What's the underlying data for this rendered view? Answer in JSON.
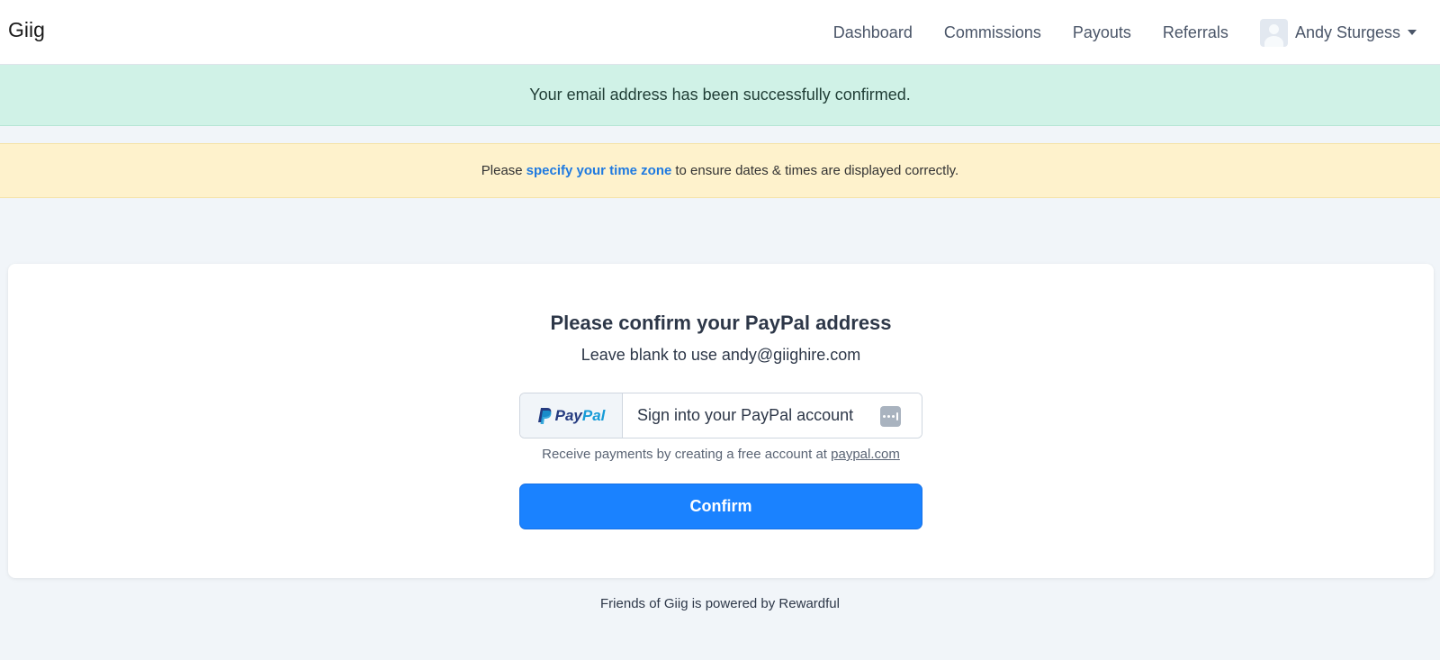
{
  "navbar": {
    "brand": "Giig",
    "links": [
      "Dashboard",
      "Commissions",
      "Payouts",
      "Referrals"
    ],
    "user_name": "Andy Sturgess"
  },
  "alerts": {
    "success": "Your email address has been successfully confirmed.",
    "warning_prefix": "Please",
    "warning_link": "specify your time zone",
    "warning_suffix": "to ensure dates & times are displayed correctly."
  },
  "card": {
    "title": "Please confirm your PayPal address",
    "subtitle": "Leave blank to use andy@giighire.com",
    "paypal_logo_pay": "Pay",
    "paypal_logo_pal": "Pal",
    "input_placeholder": "Sign into your PayPal account",
    "input_value": "",
    "helper_text": "Receive payments by creating a free account at",
    "helper_link": "paypal.com",
    "confirm_label": "Confirm"
  },
  "footer": {
    "text": "Friends of Giig is powered by Rewardful"
  },
  "colors": {
    "primary": "#1a82ff",
    "success_bg": "#d0f2e7",
    "warning_bg": "#fef2cc",
    "paypal_dark": "#253b80",
    "paypal_light": "#179bd7"
  }
}
